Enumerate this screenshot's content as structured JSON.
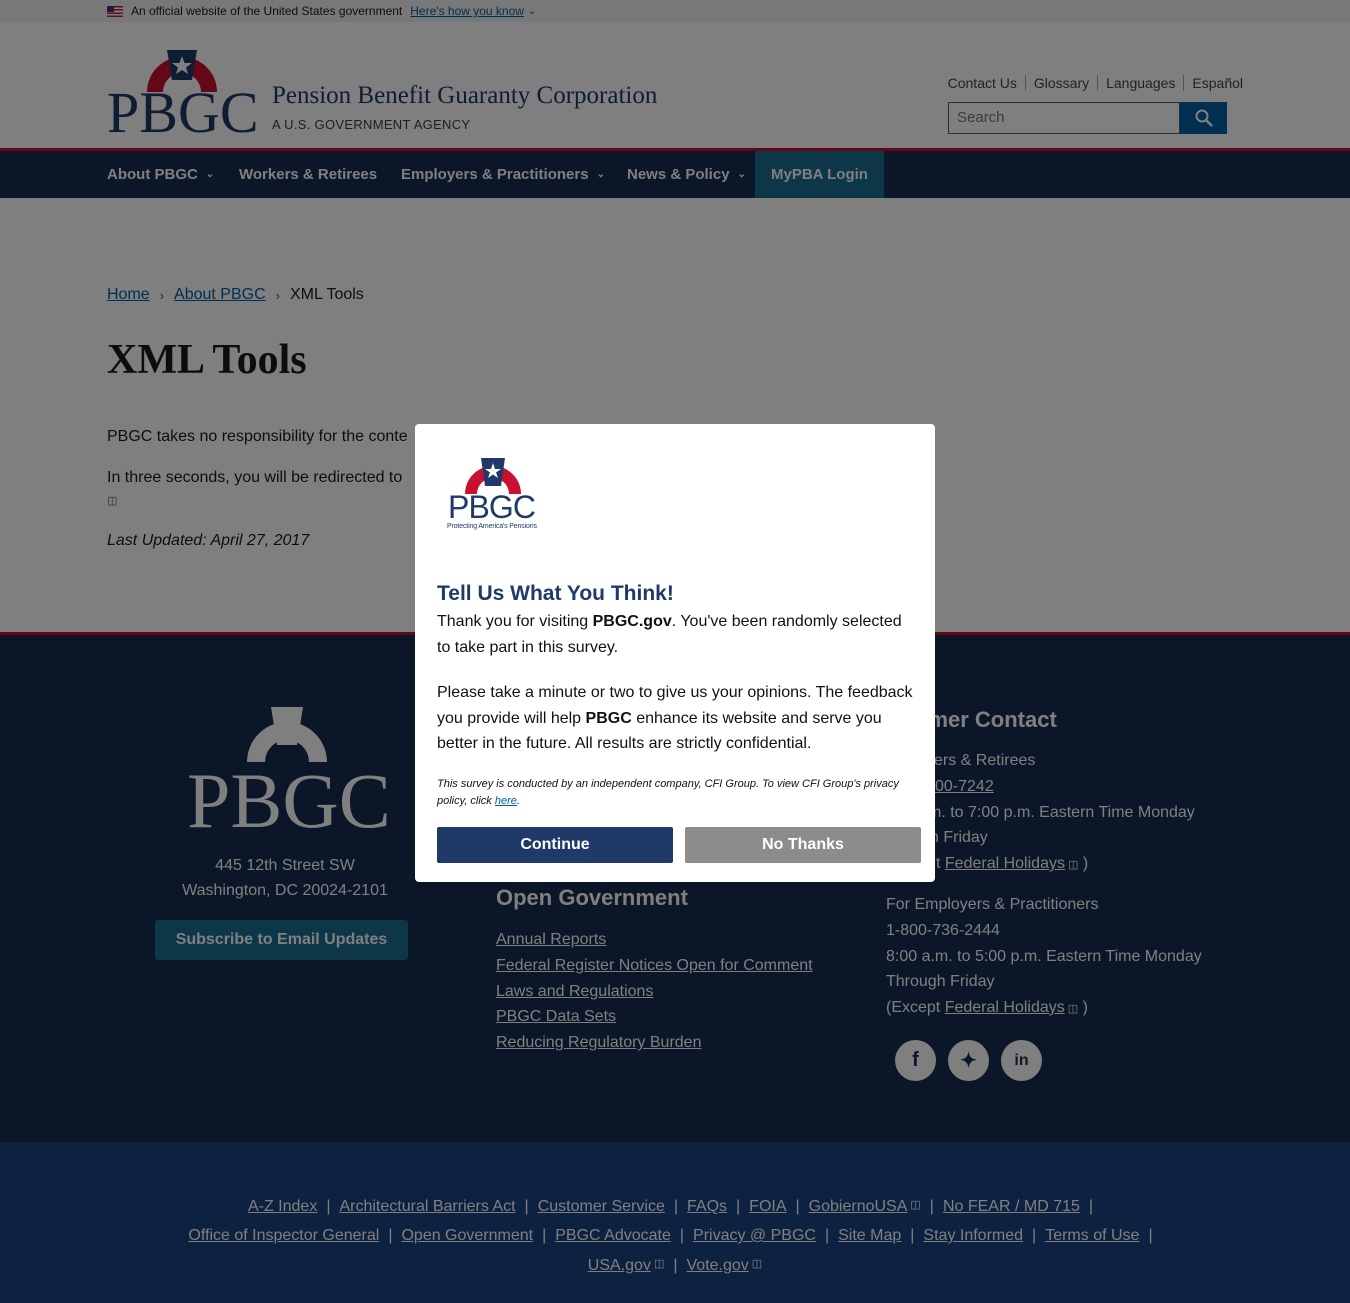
{
  "gov_banner": {
    "text": "An official website of the United States government",
    "how_link": "Here's how you know"
  },
  "header": {
    "logo_text": "PBGC",
    "org_name": "Pension Benefit Guaranty Corporation",
    "org_sub": "A U.S. GOVERNMENT AGENCY",
    "util_links": [
      "Contact Us",
      "Glossary",
      "Languages",
      "Español"
    ],
    "search_placeholder": "Search"
  },
  "nav": {
    "items": [
      "About PBGC",
      "Workers & Retirees",
      "Employers & Practitioners",
      "News & Policy",
      "MyPBA Login"
    ]
  },
  "breadcrumb": [
    "Home",
    "About PBGC",
    "XML Tools"
  ],
  "page": {
    "title": "XML Tools",
    "para1": "PBGC takes no responsibility for the conte",
    "para2": "In three seconds, you will be redirected to",
    "updated": "Last Updated: April 27, 2017"
  },
  "footer": {
    "logo_text": "PBGC",
    "address_line1": "445 12th Street SW",
    "address_line2": "Washington, DC 20024-2101",
    "subscribe": "Subscribe to Email Updates",
    "open_gov_title": "Open Government",
    "open_gov_links": [
      "Annual Reports",
      "Federal Register Notices Open for Comment",
      "Laws and Regulations",
      "PBGC Data Sets",
      "Reducing Regulatory Burden"
    ],
    "cc_title_visible": "omer Contact",
    "workers_label_visible": "kers & Retirees",
    "workers_phone_visible": "00-7242",
    "workers_hours_visible": "m. to 7:00 p.m. Eastern Time Monday",
    "workers_days_visible": "h Friday",
    "workers_except_visible": "t",
    "employers_label": "For Employers & Practitioners",
    "employers_phone": "1-800-736-2444",
    "employers_hours": "8:00 a.m. to 5:00 p.m. Eastern Time Monday",
    "employers_days": "Through Friday",
    "except_prefix": "(Except",
    "federal_holidays": "Federal Holidays",
    "except_suffix": ")",
    "social": [
      "facebook-icon",
      "twitter-icon",
      "linkedin-icon"
    ]
  },
  "bottom_links": {
    "row1": [
      "A-Z Index",
      "Architectural Barriers Act",
      "Customer Service",
      "FAQs",
      "FOIA",
      "GobiernoUSA",
      "No FEAR / MD 715"
    ],
    "row2": [
      "Office of Inspector General",
      "Open Government",
      "PBGC Advocate",
      "Privacy @ PBGC",
      "Site Map",
      "Stay Informed",
      "Terms of Use"
    ],
    "row3": [
      "USA.gov",
      "Vote.gov"
    ]
  },
  "modal": {
    "logo_text": "PBGC",
    "logo_tagline": "Protecting America's Pensions",
    "title": "Tell Us What You Think!",
    "p1_a": "Thank you for visiting ",
    "p1_b": "PBGC.gov",
    "p1_c": ". You've been randomly selected to take part in this survey.",
    "p2_a": "Please take a minute or two to give us your opinions. The feedback you provide will help ",
    "p2_b": "PBGC",
    "p2_c": " enhance its website and serve you better in the future. All results are strictly confidential.",
    "small_a": "This survey is conducted by an independent company, CFI Group. To view CFI Group's privacy policy, click ",
    "small_link": "here",
    "small_b": ".",
    "continue": "Continue",
    "no_thanks": "No Thanks"
  },
  "colors": {
    "navy": "#162e51",
    "brand_blue": "#1f3a68",
    "accent_red": "#c9102f",
    "link_blue": "#005ea2"
  }
}
